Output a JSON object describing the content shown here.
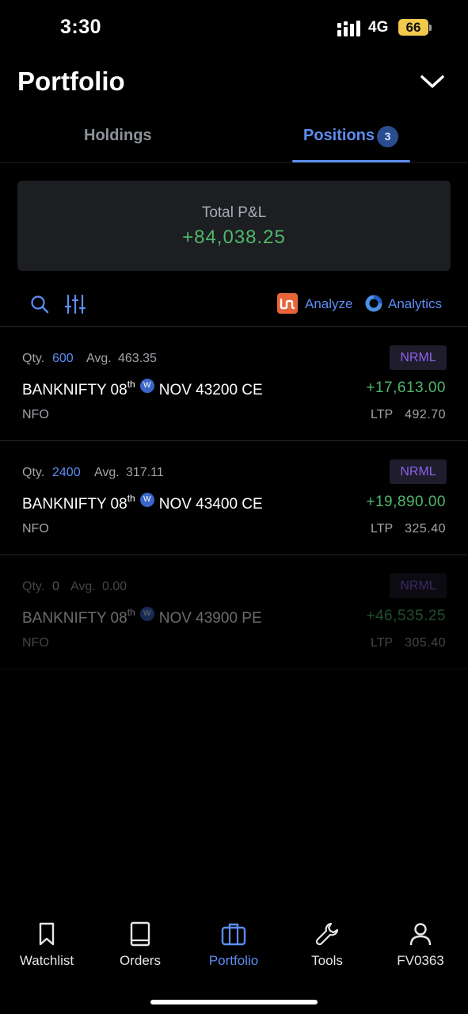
{
  "status_bar": {
    "time": "3:30",
    "network": "4G",
    "battery": "66"
  },
  "header": {
    "title": "Portfolio",
    "collapse_icon": "chevron-down-icon"
  },
  "tabs": [
    {
      "label": "Holdings",
      "active": false
    },
    {
      "label": "Positions",
      "active": true,
      "badge": "3"
    }
  ],
  "summary": {
    "label": "Total P&L",
    "value": "+84,038.25"
  },
  "toolbar": {
    "search_icon": "search-icon",
    "filter_icon": "filter-sliders-icon",
    "analyze_label": "Analyze",
    "analytics_label": "Analytics"
  },
  "positions": [
    {
      "qty_label": "Qty.",
      "qty": "600",
      "avg_label": "Avg.",
      "avg": "463.35",
      "product": "NRML",
      "symbol_prefix": "BANKNIFTY 08",
      "symbol_sup": "th",
      "weekly": "W",
      "symbol_suffix": "NOV 43200 CE",
      "pnl": "+17,613.00",
      "exchange": "NFO",
      "ltp_label": "LTP",
      "ltp": "492.70",
      "closed": false
    },
    {
      "qty_label": "Qty.",
      "qty": "2400",
      "avg_label": "Avg.",
      "avg": "317.11",
      "product": "NRML",
      "symbol_prefix": "BANKNIFTY 08",
      "symbol_sup": "th",
      "weekly": "W",
      "symbol_suffix": "NOV 43400 CE",
      "pnl": "+19,890.00",
      "exchange": "NFO",
      "ltp_label": "LTP",
      "ltp": "325.40",
      "closed": false
    },
    {
      "qty_label": "Qty.",
      "qty": "0",
      "avg_label": "Avg.",
      "avg": "0.00",
      "product": "NRML",
      "symbol_prefix": "BANKNIFTY 08",
      "symbol_sup": "th",
      "weekly": "W",
      "symbol_suffix": "NOV 43900 PE",
      "pnl": "+46,535.25",
      "exchange": "NFO",
      "ltp_label": "LTP",
      "ltp": "305.40",
      "closed": true
    }
  ],
  "bottom_nav": [
    {
      "label": "Watchlist",
      "icon": "bookmark-icon",
      "active": false
    },
    {
      "label": "Orders",
      "icon": "book-icon",
      "active": false
    },
    {
      "label": "Portfolio",
      "icon": "briefcase-icon",
      "active": true
    },
    {
      "label": "Tools",
      "icon": "wrench-icon",
      "active": false
    },
    {
      "label": "FV0363",
      "icon": "user-icon",
      "active": false
    }
  ],
  "colors": {
    "accent": "#5d8df3",
    "profit": "#4fb86b",
    "product_badge": "#8a63e8",
    "analyze_brand": "#e8643a"
  }
}
